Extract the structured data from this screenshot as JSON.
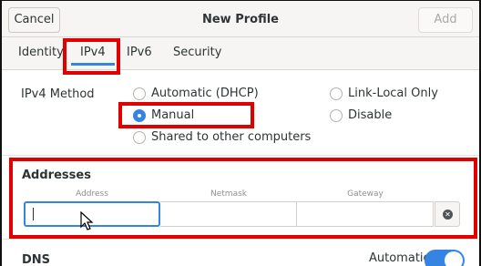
{
  "header": {
    "title": "New Profile",
    "cancel_label": "Cancel",
    "add_label": "Add"
  },
  "tabs": [
    {
      "label": "Identity",
      "selected": false
    },
    {
      "label": "IPv4",
      "selected": true
    },
    {
      "label": "IPv6",
      "selected": false
    },
    {
      "label": "Security",
      "selected": false
    }
  ],
  "ipv4": {
    "method_label": "IPv4 Method",
    "methods": [
      {
        "label": "Automatic (DHCP)",
        "checked": false
      },
      {
        "label": "Manual",
        "checked": true
      },
      {
        "label": "Shared to other computers",
        "checked": false
      },
      {
        "label": "Link-Local Only",
        "checked": false
      },
      {
        "label": "Disable",
        "checked": false
      }
    ]
  },
  "addresses": {
    "title": "Addresses",
    "columns": [
      "Address",
      "Netmask",
      "Gateway"
    ],
    "row": {
      "address": "",
      "netmask": "",
      "gateway": ""
    }
  },
  "dns": {
    "title": "DNS",
    "automatic_label": "Automatic",
    "automatic_on": true
  },
  "colors": {
    "accent": "#3584e4",
    "highlight": "#e00000"
  },
  "icons": {
    "clear": "clear-row-icon",
    "pointer": "mouse-pointer-icon"
  }
}
